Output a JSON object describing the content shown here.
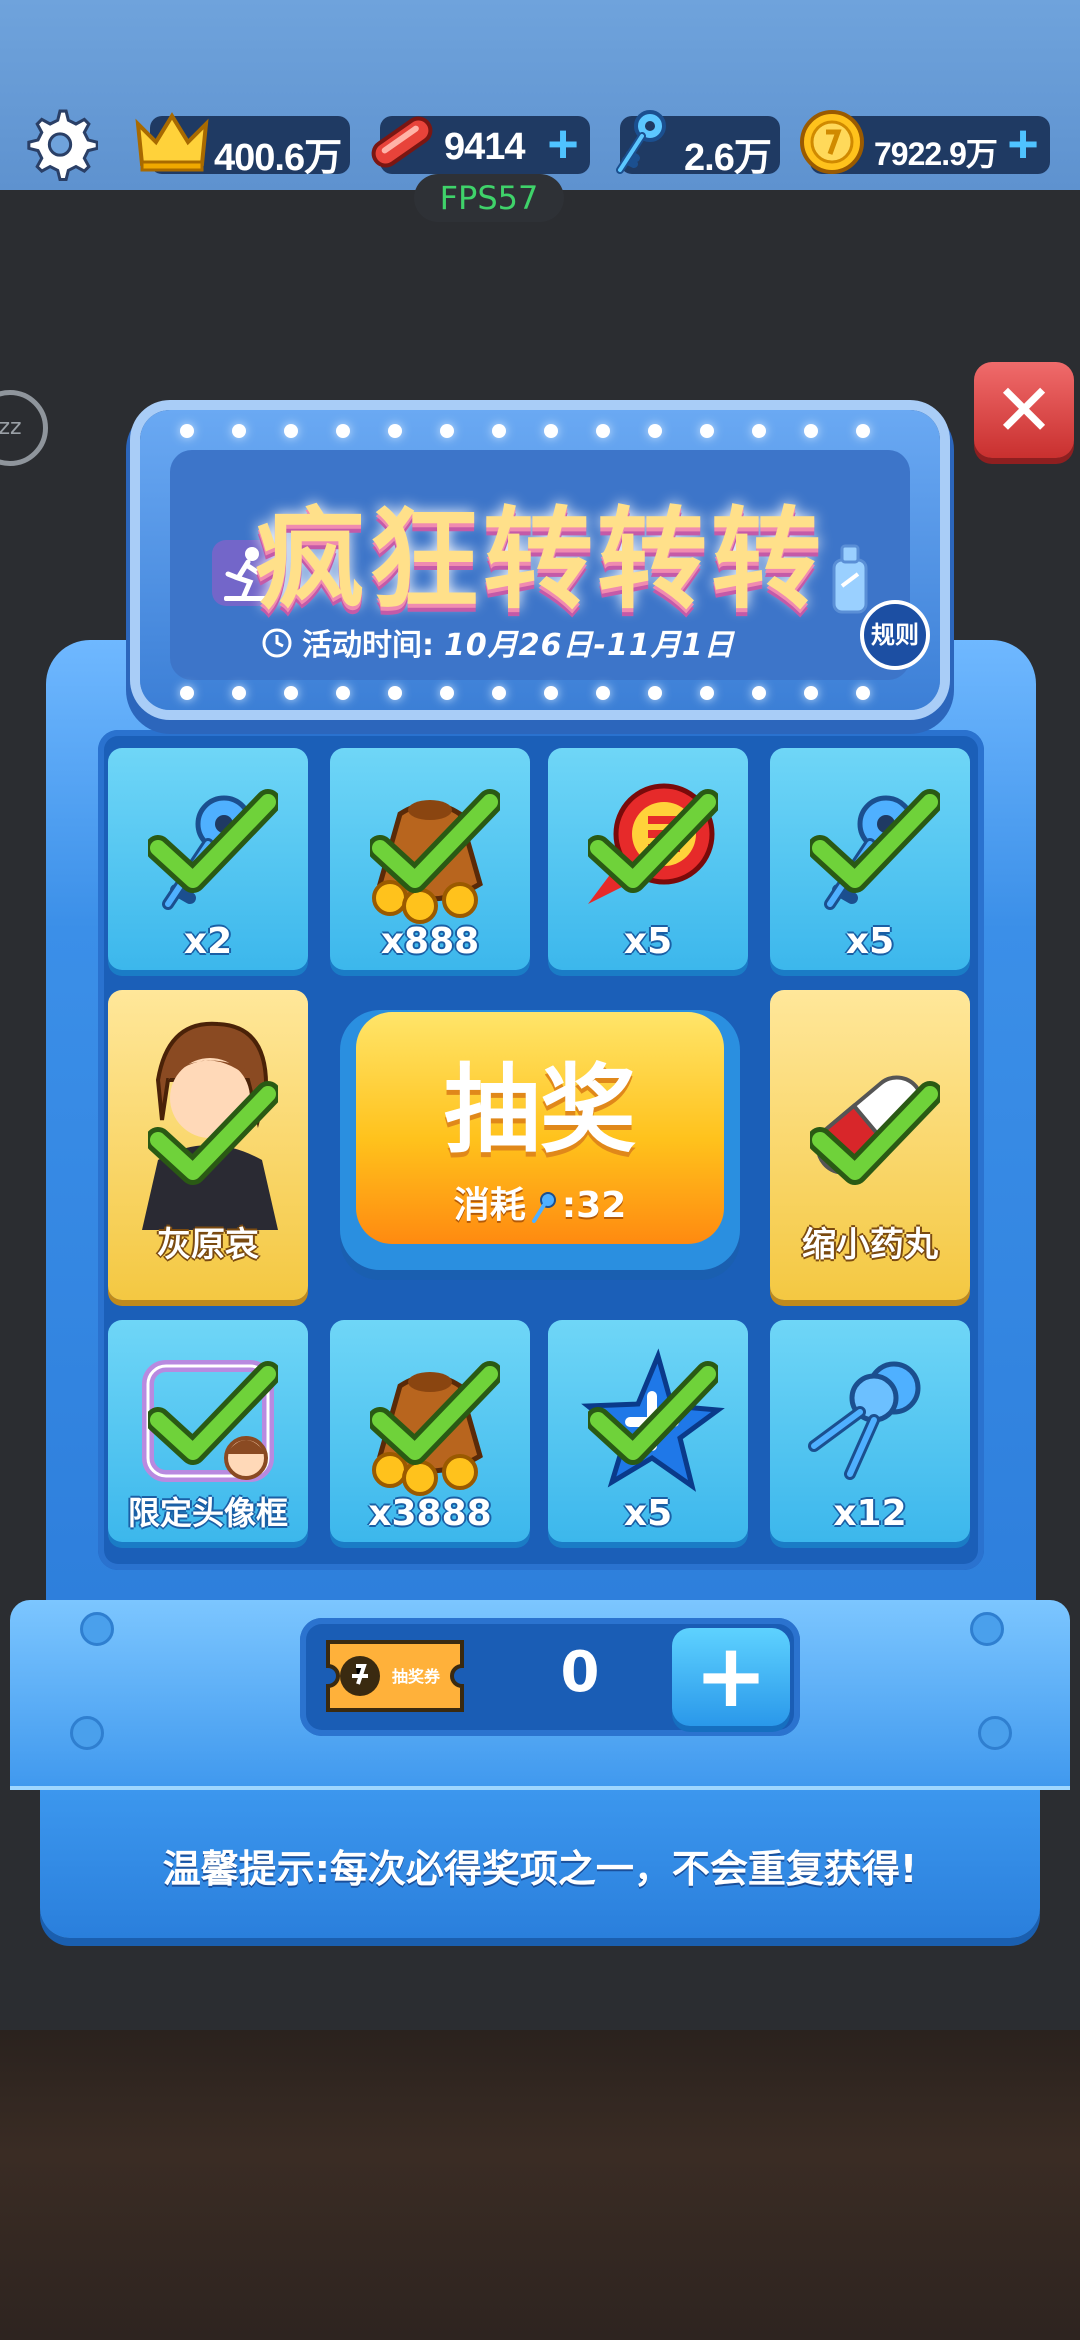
{
  "topbar": {
    "resources": [
      {
        "name": "crown",
        "value": "400.6万",
        "has_plus": false
      },
      {
        "name": "skateboard",
        "value": "9414",
        "has_plus": true
      },
      {
        "name": "key",
        "value": "2.6万",
        "has_plus": false
      },
      {
        "name": "coin",
        "value": "7922.9万",
        "has_plus": true
      }
    ],
    "fps": "FPS57"
  },
  "overlay": {
    "side_bubble": "zz"
  },
  "event": {
    "title": "疯狂转转转",
    "time_label": "活动时间:",
    "time_value": "10月26日-11月1日",
    "rules_label": "规则"
  },
  "prizes": [
    {
      "icon": "key-icon",
      "label": "x2",
      "claimed": true
    },
    {
      "icon": "coin-bag-icon",
      "label": "x888",
      "claimed": true
    },
    {
      "icon": "rocket-boost-icon",
      "label": "x5",
      "claimed": true
    },
    {
      "icon": "key-icon",
      "label": "x5",
      "claimed": true
    },
    {
      "icon": "character-avatar-icon",
      "label": "灰原哀",
      "claimed": true
    },
    {
      "icon": "pill-icon",
      "label": "缩小药丸",
      "claimed": true
    },
    {
      "icon": "avatar-frame-icon",
      "label": "限定头像框",
      "claimed": true
    },
    {
      "icon": "coin-bag-icon",
      "label": "x3888",
      "claimed": true
    },
    {
      "icon": "star-icon",
      "label": "x5",
      "claimed": true
    },
    {
      "icon": "keys-bunch-icon",
      "label": "x12",
      "claimed": false
    }
  ],
  "draw": {
    "label": "抽奖",
    "cost_prefix": "消耗",
    "cost_value": ":32"
  },
  "tickets": {
    "icon_label": "抽奖券",
    "count": "0"
  },
  "tip": "温馨提示:每次必得奖项之一，不会重复获得!",
  "colors": {
    "accent": "#2e7fdc",
    "gold": "#ffc21c",
    "close": "#c9302f",
    "check": "#6fd23a"
  }
}
